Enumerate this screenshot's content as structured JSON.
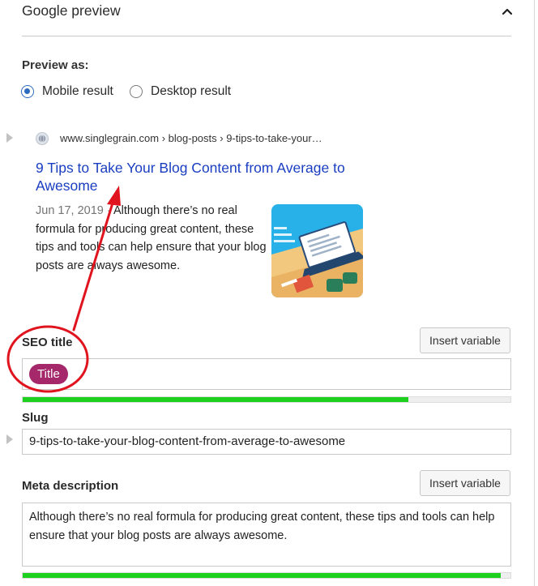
{
  "header": {
    "title": "Google preview"
  },
  "preview_as": {
    "label": "Preview as:",
    "options": [
      {
        "label": "Mobile result",
        "selected": true
      },
      {
        "label": "Desktop result",
        "selected": false
      }
    ]
  },
  "serp": {
    "url": "www.singlegrain.com › blog-posts › 9-tips-to-take-your…",
    "title": "9 Tips to Take Your Blog Content from Average to Awesome",
    "date": "Jun 17, 2019 ·",
    "snippet": " Although there’s no real formula for producing great content, these tips and tools can help ensure that your blog posts are always awesome.",
    "thumb_icon": "laptop-illustration-icon"
  },
  "seo_title": {
    "label": "SEO title",
    "insert_variable": "Insert variable",
    "pill": "Title",
    "progress": 0.79,
    "progress_color": "#1ed01e",
    "pill_color": "#a4286a"
  },
  "slug": {
    "label": "Slug",
    "value": "9-tips-to-take-your-blog-content-from-average-to-awesome"
  },
  "meta_description": {
    "label": "Meta description",
    "insert_variable": "Insert variable",
    "value": "Although there’s no real formula for producing great content, these tips and tools can help ensure that your blog posts are always awesome.",
    "progress": 0.98
  },
  "colors": {
    "link": "#1a3ec1",
    "annotation_red": "#e0141e",
    "radio_blue": "#2d6bbf"
  }
}
